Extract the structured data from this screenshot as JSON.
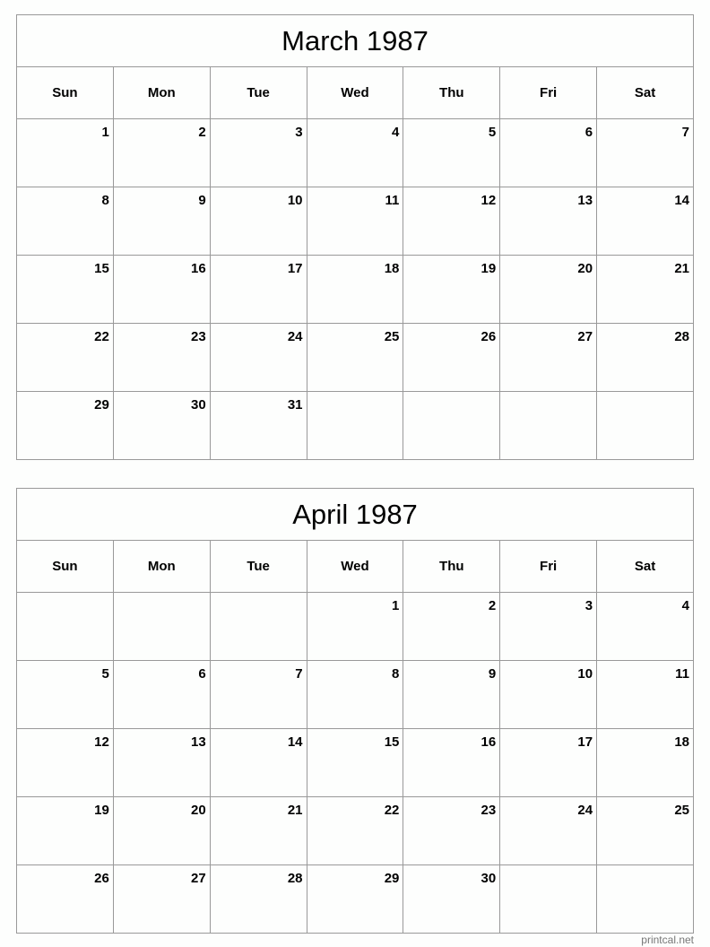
{
  "calendars": [
    {
      "title": "March 1987",
      "weekdays": [
        "Sun",
        "Mon",
        "Tue",
        "Wed",
        "Thu",
        "Fri",
        "Sat"
      ],
      "weeks": [
        [
          "1",
          "2",
          "3",
          "4",
          "5",
          "6",
          "7"
        ],
        [
          "8",
          "9",
          "10",
          "11",
          "12",
          "13",
          "14"
        ],
        [
          "15",
          "16",
          "17",
          "18",
          "19",
          "20",
          "21"
        ],
        [
          "22",
          "23",
          "24",
          "25",
          "26",
          "27",
          "28"
        ],
        [
          "29",
          "30",
          "31",
          "",
          "",
          "",
          ""
        ]
      ]
    },
    {
      "title": "April 1987",
      "weekdays": [
        "Sun",
        "Mon",
        "Tue",
        "Wed",
        "Thu",
        "Fri",
        "Sat"
      ],
      "weeks": [
        [
          "",
          "",
          "",
          "1",
          "2",
          "3",
          "4"
        ],
        [
          "5",
          "6",
          "7",
          "8",
          "9",
          "10",
          "11"
        ],
        [
          "12",
          "13",
          "14",
          "15",
          "16",
          "17",
          "18"
        ],
        [
          "19",
          "20",
          "21",
          "22",
          "23",
          "24",
          "25"
        ],
        [
          "26",
          "27",
          "28",
          "29",
          "30",
          "",
          ""
        ]
      ]
    }
  ],
  "footer": "printcal.net"
}
